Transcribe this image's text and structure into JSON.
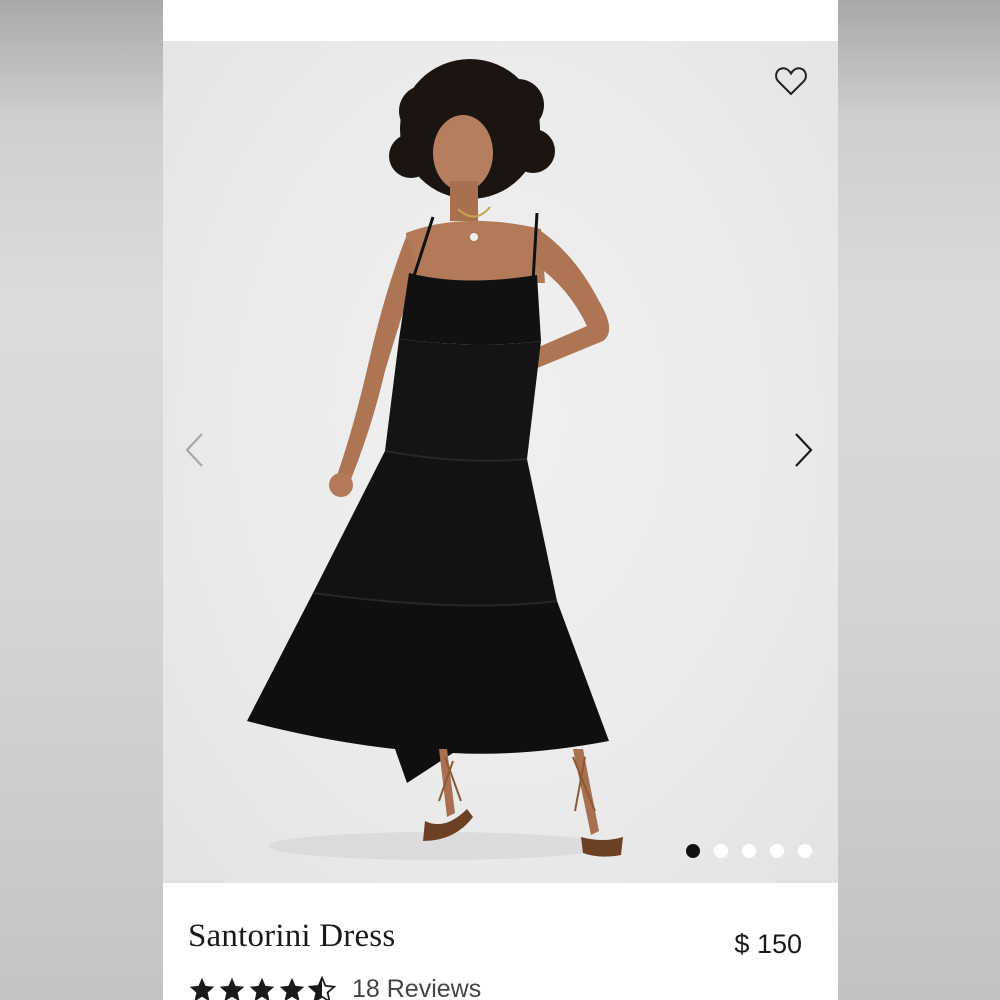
{
  "product": {
    "title": "Santorini Dress",
    "price": "$ 150",
    "rating": 4.5,
    "reviews_label": "18 Reviews"
  },
  "gallery": {
    "image_count": 5,
    "active_index": 0,
    "image_alt": "Model wearing black tiered maxi dress"
  },
  "icons": {
    "favorite": "heart-icon",
    "previous": "chevron-left-icon",
    "next": "chevron-right-icon",
    "rating": "star-icon"
  },
  "colors": {
    "dress": "#111111",
    "background": "#ececec",
    "active_dot": "#111111",
    "inactive_dot": "#ffffff"
  }
}
